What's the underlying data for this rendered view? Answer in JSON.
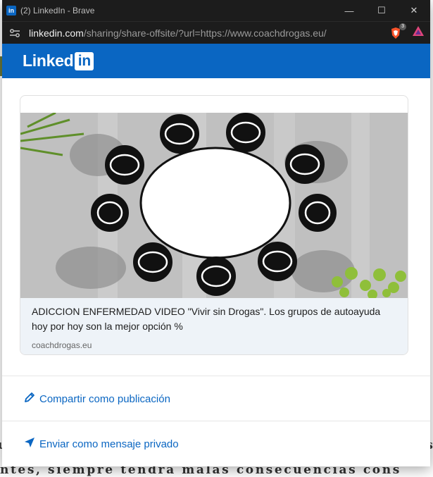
{
  "window": {
    "title": "(2) LinkedIn - Brave",
    "app_icon_text": "in",
    "controls": {
      "minimize": "—",
      "maximize": "☐",
      "close": "✕"
    }
  },
  "address": {
    "host": "linkedin.com",
    "path": "/sharing/share-offsite/?url=https://www.coachdrogas.eu/",
    "shield_count": "3"
  },
  "linkedin": {
    "logo_text": "Linked",
    "logo_box_text": "in"
  },
  "preview": {
    "title": "ADICCION ENFERMEDAD VIDEO \"Vivir sin Drogas\". Los grupos de autoayuda hoy por hoy son la mejor opción %",
    "domain": "coachdrogas.eu"
  },
  "actions": {
    "share_post": "Compartir como publicación",
    "send_message": "Enviar como mensaje privado"
  },
  "background": {
    "bottom_text": "ntes, siempre tendrá malas consecuencias cons",
    "left_char": "u",
    "right_char": "s"
  },
  "colors": {
    "linkedin_blue": "#0a66c2",
    "card_meta_bg": "#eef3f8",
    "titlebar_bg": "#1c1c1c"
  },
  "icons": {
    "site_settings": "site-settings-icon",
    "brave_shield": "brave-shield-icon",
    "brave_rewards": "brave-rewards-icon",
    "pencil": "pencil-icon",
    "send": "send-icon"
  }
}
